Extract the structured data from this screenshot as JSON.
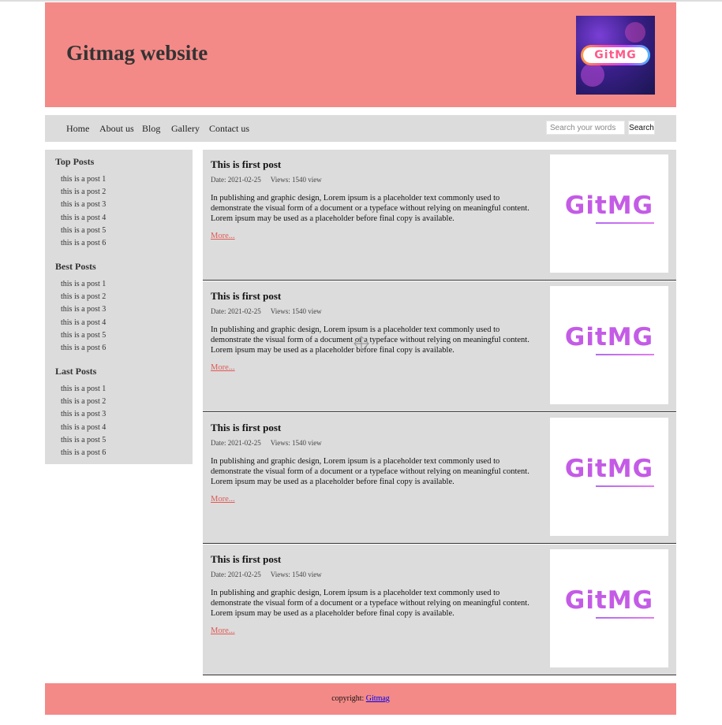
{
  "header": {
    "site_title": "Gitmag website",
    "logo_text": "GitMG"
  },
  "nav": {
    "items": [
      {
        "label": "Home"
      },
      {
        "label": "About us"
      },
      {
        "label": "Blog"
      },
      {
        "label": "Gallery"
      },
      {
        "label": "Contact us"
      }
    ],
    "search_placeholder": "Search your words",
    "search_button": "Search"
  },
  "sidebar": {
    "sections": [
      {
        "heading": "Top Posts",
        "items": [
          "this is a post 1",
          "this is a post 2",
          "this is a post 3",
          "this is a post 4",
          "this is a post 5",
          "this is a post 6"
        ]
      },
      {
        "heading": "Best Posts",
        "items": [
          "this is a post 1",
          "this is a post 2",
          "this is a post 3",
          "this is a post 4",
          "this is a post 5",
          "this is a post 6"
        ]
      },
      {
        "heading": "Last Posts",
        "items": [
          "this is a post 1",
          "this is a post 2",
          "this is a post 3",
          "this is a post 4",
          "this is a post 5",
          "this is a post 6"
        ]
      }
    ]
  },
  "posts": [
    {
      "title": "This is first post",
      "date": "Date: 2021-02-25",
      "views": "Views: 1540 view",
      "excerpt": "In publishing and graphic design, Lorem ipsum is a placeholder text commonly used to demonstrate the visual form of a document or a typeface without relying on meaningful content. Lorem ipsum may be used as a placeholder before final copy is available.",
      "more": "More...",
      "thumb_text": "GitMG"
    },
    {
      "title": "This is first post",
      "date": "Date: 2021-02-25",
      "views": "Views: 1540 view",
      "excerpt": "In publishing and graphic design, Lorem ipsum is a placeholder text commonly used to demonstrate the visual form of a document or a typeface without relying on meaningful content. Lorem ipsum may be used as a placeholder before final copy is available.",
      "more": "More...",
      "thumb_text": "GitMG"
    },
    {
      "title": "This is first post",
      "date": "Date: 2021-02-25",
      "views": "Views: 1540 view",
      "excerpt": "In publishing and graphic design, Lorem ipsum is a placeholder text commonly used to demonstrate the visual form of a document or a typeface without relying on meaningful content. Lorem ipsum may be used as a placeholder before final copy is available.",
      "more": "More...",
      "thumb_text": "GitMG"
    },
    {
      "title": "This is first post",
      "date": "Date: 2021-02-25",
      "views": "Views: 1540 view",
      "excerpt": "In publishing and graphic design, Lorem ipsum is a placeholder text commonly used to demonstrate the visual form of a document or a typeface without relying on meaningful content. Lorem ipsum may be used as a placeholder before final copy is available.",
      "more": "More...",
      "thumb_text": "GitMG"
    }
  ],
  "footer": {
    "prefix": "copyright: ",
    "link_label": "Gitmag"
  },
  "colors": {
    "header_bg": "#f38a87",
    "panel_bg": "#dcdcdc",
    "link_accent": "#e05a56"
  }
}
